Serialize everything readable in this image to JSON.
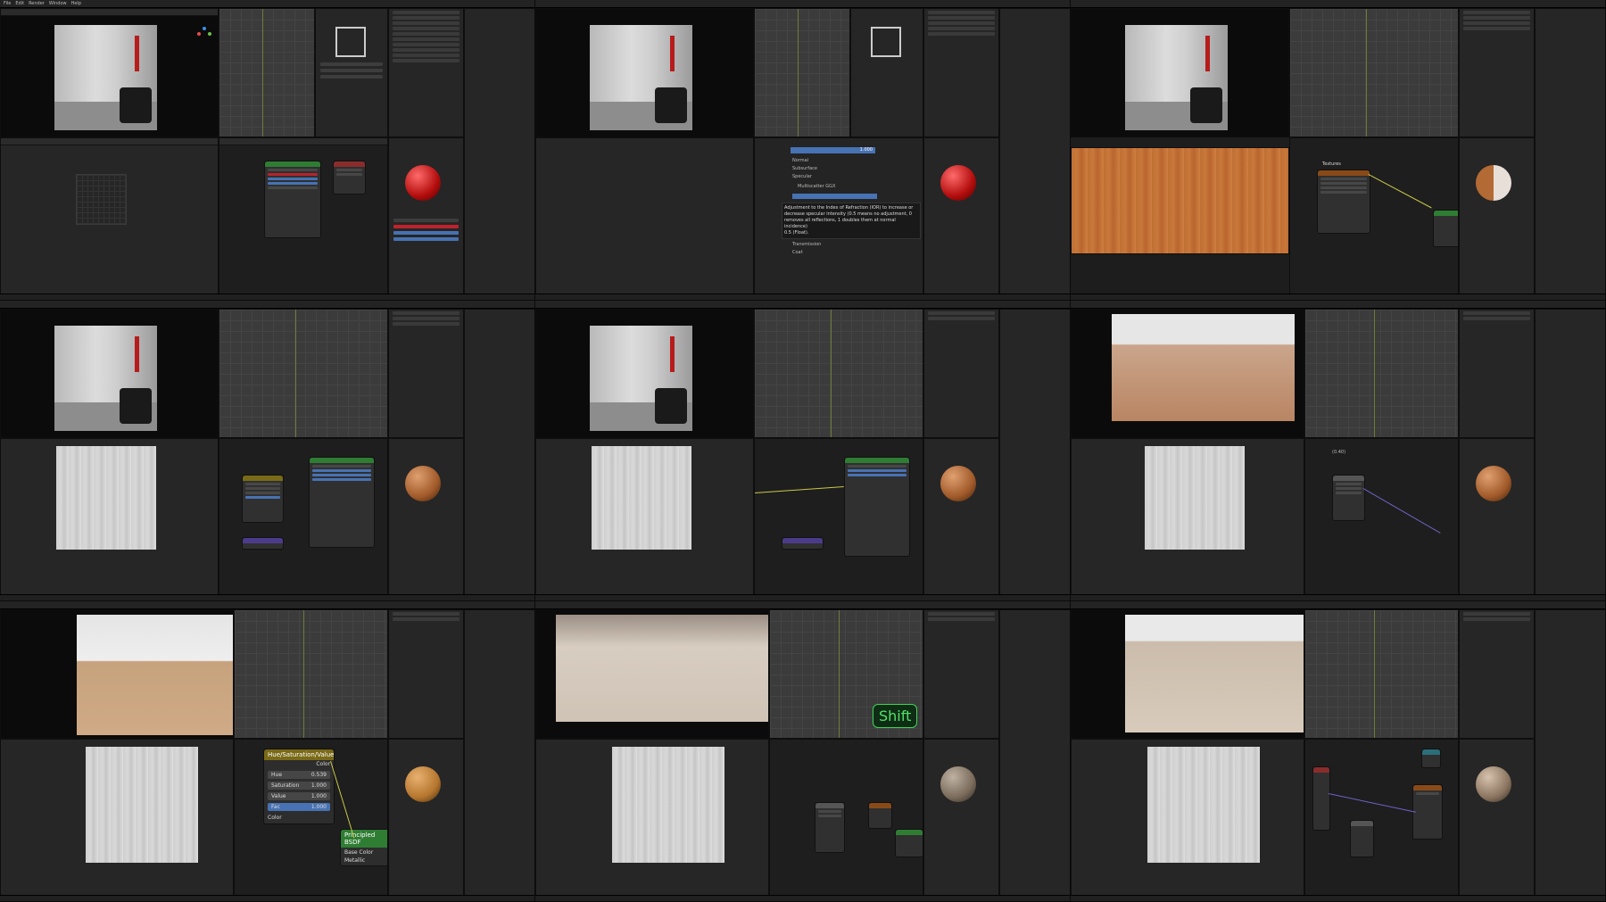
{
  "window": {
    "app": "Blender"
  },
  "menu": [
    "File",
    "Edit",
    "Render",
    "Window",
    "Help"
  ],
  "tile_labels": {
    "tile2_tooltip": "Adjustment to the Index of Refraction (IOR) to increase or decrease specular intensity (0.5 means no adjustment, 0 removes all reflections, 1 doubles them at normal incidence)",
    "tile2_tooltip_value": "0.5 (Float).",
    "tile2_panel_items": [
      "Normal",
      "Subsurface",
      "Specular",
      "Multiscatter GGX",
      "Transmission",
      "Coat"
    ],
    "tile2_value": "1.000",
    "tile3_textures_label": "Textures",
    "tile6_coord": "(0.40)",
    "tile8_shift": "Shift"
  },
  "hsv_node": {
    "title": "Hue/Saturation/Value",
    "out": "Color",
    "rows": [
      {
        "label": "Hue",
        "value": "0.539"
      },
      {
        "label": "Saturation",
        "value": "1.000"
      },
      {
        "label": "Value",
        "value": "1.000"
      },
      {
        "label": "Fac",
        "value": "1.000"
      }
    ],
    "in": "Color"
  },
  "principled_node": {
    "title": "Principled BSDF",
    "input": "Base Color",
    "input2": "Metallic"
  },
  "colors": {
    "accent": "#4772b3",
    "node_green": "#2f7d33",
    "wire_yellow": "#c8c84a",
    "shift_green": "#3ed35a"
  }
}
